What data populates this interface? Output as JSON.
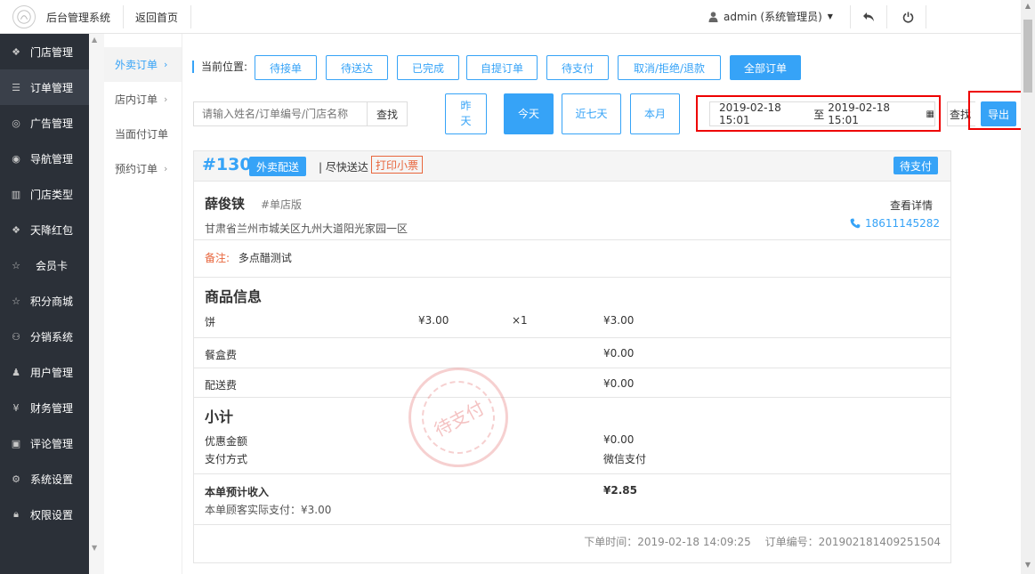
{
  "header": {
    "app_title": "后台管理系统",
    "back_home": "返回首页",
    "user": "admin (系统管理员)"
  },
  "sidebar": {
    "items": [
      {
        "label": "门店管理",
        "icon": "cubes-icon"
      },
      {
        "label": "订单管理",
        "icon": "list-icon"
      },
      {
        "label": "广告管理",
        "icon": "lifebuoy-icon"
      },
      {
        "label": "导航管理",
        "icon": "compass-icon"
      },
      {
        "label": "门店类型",
        "icon": "bank-icon"
      },
      {
        "label": "天降红包",
        "icon": "cubes-icon"
      },
      {
        "label": "会员卡",
        "icon": "star-icon"
      },
      {
        "label": "积分商城",
        "icon": "star-icon"
      },
      {
        "label": "分销系统",
        "icon": "users-icon"
      },
      {
        "label": "用户管理",
        "icon": "user-icon"
      },
      {
        "label": "财务管理",
        "icon": "yen-icon"
      },
      {
        "label": "评论管理",
        "icon": "money-icon"
      },
      {
        "label": "系统设置",
        "icon": "gear-icon"
      },
      {
        "label": "权限设置",
        "icon": "lock-icon"
      }
    ]
  },
  "subnav": {
    "items": [
      {
        "label": "外卖订单",
        "chevron": "›"
      },
      {
        "label": "店内订单",
        "chevron": "›"
      },
      {
        "label": "当面付订单",
        "chevron": ""
      },
      {
        "label": "预约订单",
        "chevron": "›"
      }
    ]
  },
  "filters": {
    "crumb": "当前位置:",
    "status_buttons": [
      "待接单",
      "待送达",
      "已完成",
      "自提订单",
      "待支付",
      "取消/拒绝/退款",
      "全部订单"
    ],
    "search_placeholder": "请输入姓名/订单编号/门店名称",
    "search_label": "查找",
    "date_buttons": [
      "昨天",
      "今天",
      "近七天",
      "本月"
    ],
    "date_start": "2019-02-18 15:01",
    "date_sep": "至",
    "date_end": "2019-02-18 15:01",
    "search_label2": "查找",
    "export_label": "导出"
  },
  "order": {
    "number": "#130",
    "type": "外卖配送",
    "delivery": "| 尽快送达",
    "print": "打印小票",
    "status": "待支付",
    "customer": "薛俊铗",
    "version": "#单店版",
    "address": "甘肃省兰州市城关区九州大道阳光家园一区",
    "view_detail": "查看详情",
    "phone": "18611145282",
    "remark_label": "备注:",
    "remark": "多点醋测试",
    "goods_title": "商品信息",
    "goods": [
      {
        "name": "饼",
        "price": "¥3.00",
        "qty": "×1",
        "total": "¥3.00"
      }
    ],
    "box_fee_label": "餐盒费",
    "box_fee": "¥0.00",
    "delivery_fee_label": "配送费",
    "delivery_fee": "¥0.00",
    "subtotal_title": "小计",
    "discount_label": "优惠金额",
    "discount": "¥0.00",
    "pay_method_label": "支付方式",
    "pay_method": "微信支付",
    "income_label": "本单预计收入",
    "income": "¥2.85",
    "paid_text": "本单顾客实际支付：¥3.00",
    "order_time": "下单时间：2019-02-18 14:09:25",
    "order_id": "订单编号：201902181409251504",
    "stamp": "待支付"
  },
  "colors": {
    "accent": "#36a3f7",
    "sidebar": "#2b3038",
    "warn": "#e8663d",
    "highlight": "#ee0000"
  }
}
